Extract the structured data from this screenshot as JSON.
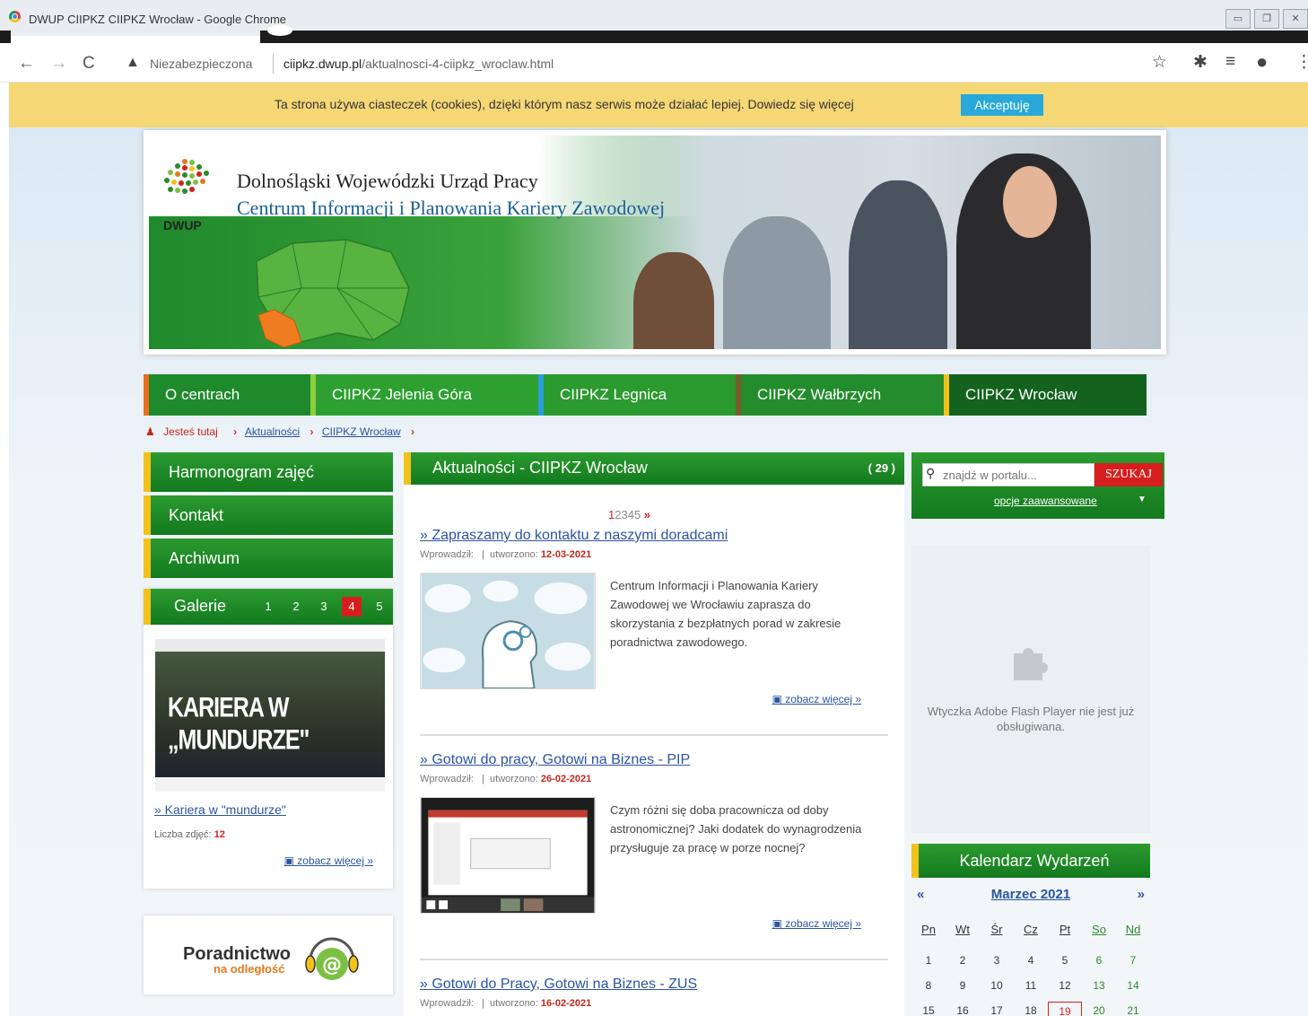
{
  "window": {
    "title": "DWUP CIIPKZ CIIPKZ Wrocław - Google Chrome"
  },
  "browser": {
    "security_label": "Niezabezpieczona",
    "url_host": "ciipkz.dwup.pl",
    "url_path": "/aktualnosci-4-ciipkz_wroclaw.html"
  },
  "cookie_bar": {
    "text": "Ta strona używa ciasteczek (cookies), dzięki którym nasz serwis może działać lepiej. Dowiedz się więcej",
    "accept_label": "Akceptuję"
  },
  "banner": {
    "logo_text": "DWUP",
    "title": "Dolnośląski Wojewódzki Urząd Pracy",
    "subtitle": "Centrum Informacji i Planowania Kariery Zawodowej"
  },
  "main_nav": [
    {
      "label": "O centrach",
      "bg": "#1f8a2c",
      "accent": "#ec6d1c"
    },
    {
      "label": "CIIPKZ Jelenia Góra",
      "bg": "#2ea032",
      "accent": "#8ccf3c"
    },
    {
      "label": "CIIPKZ Legnica",
      "bg": "#2b9a2f",
      "accent": "#2a9ed6"
    },
    {
      "label": "CIIPKZ Wałbrzych",
      "bg": "#248c2c",
      "accent": "#7a5c2e"
    },
    {
      "label": "CIIPKZ Wrocław",
      "bg": "#13621e",
      "accent": "#f2c21b"
    }
  ],
  "breadcrumb": {
    "here": "Jesteś tutaj",
    "items": [
      "Aktualności",
      "CIIPKZ Wrocław"
    ]
  },
  "left_nav": [
    "Harmonogram zajęć",
    "Kontakt",
    "Archiwum"
  ],
  "gallery": {
    "title": "Galerie",
    "pages": [
      "1",
      "2",
      "3",
      "4",
      "5"
    ],
    "active_page": "4",
    "image_caption": "KARIERA W „MUNDURZE\"",
    "link": "» Kariera w \"mundurze\"",
    "count_label": "Liczba zdjęć:",
    "count_value": "12",
    "more": "zobacz więcej »"
  },
  "poradnictwo": {
    "title": "Poradnictwo",
    "subtitle": "na odległość"
  },
  "news_section": {
    "title": "Aktualności - CIIPKZ Wrocław",
    "count": "( 29 )",
    "pages": [
      "1",
      "2",
      "3",
      "4",
      "5"
    ],
    "current_page": "1",
    "next": "»",
    "items": [
      {
        "title": "» Zapraszamy do kontaktu z naszymi doradcami",
        "author_label": "Wprowadził:",
        "created_label": "utworzono:",
        "date": "12-03-2021",
        "desc": "Centrum Informacji i Planowania Kariery Zawodowej we Wrocławiu zaprasza do skorzystania z bezpłatnych porad w zakresie poradnictwa zawodowego.",
        "more": "zobacz więcej »"
      },
      {
        "title": "» Gotowi do pracy, Gotowi na Biznes - PIP",
        "author_label": "Wprowadził:",
        "created_label": "utworzono:",
        "date": "26-02-2021",
        "desc": "Czym różni się doba pracownicza od doby astronomicznej? Jaki dodatek do wynagrodzenia przysługuje za pracę w porze nocnej?",
        "more": "zobacz więcej »"
      },
      {
        "title": "» Gotowi do Pracy, Gotowi na Biznes - ZUS",
        "author_label": "Wprowadził:",
        "created_label": "utworzono:",
        "date": "16-02-2021"
      }
    ]
  },
  "search": {
    "placeholder": "znajdź w portalu...",
    "button": "SZUKAJ",
    "advanced": "opcje zaawansowane"
  },
  "flash": {
    "message": "Wtyczka Adobe Flash Player nie jest już obsługiwana."
  },
  "calendar": {
    "title": "Kalendarz Wydarzeń",
    "month": "Marzec 2021",
    "prev": "«",
    "next": "»",
    "day_headers": [
      "Pn",
      "Wt",
      "Śr",
      "Cz",
      "Pt",
      "So",
      "Nd"
    ],
    "days": [
      "1",
      "2",
      "3",
      "4",
      "5",
      "6",
      "7",
      "8",
      "9",
      "10",
      "11",
      "12",
      "13",
      "14",
      "15",
      "16",
      "17",
      "18",
      "19",
      "20",
      "21"
    ],
    "today": "19"
  }
}
